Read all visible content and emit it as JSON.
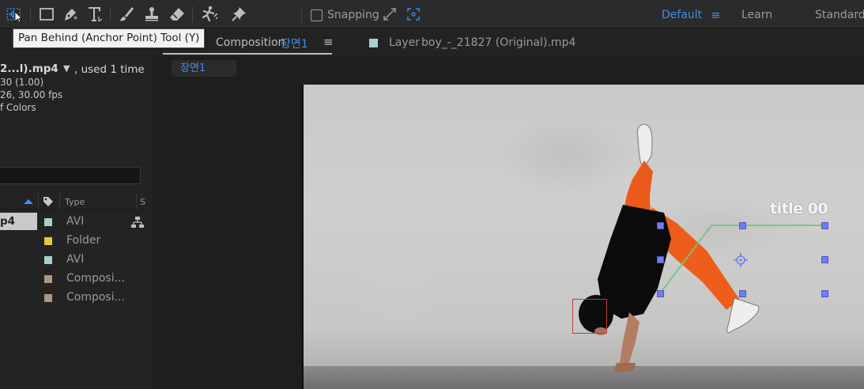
{
  "toolbar": {
    "tools": [
      {
        "name": "pan-behind-tool",
        "icon": "pan-behind-icon",
        "active": true
      },
      {
        "name": "rectangle-tool",
        "icon": "rectangle-icon"
      },
      {
        "name": "pen-tool",
        "icon": "pen-icon"
      },
      {
        "name": "type-tool",
        "icon": "type-icon"
      },
      {
        "name": "brush-tool",
        "icon": "brush-icon"
      },
      {
        "name": "clone-stamp-tool",
        "icon": "stamp-icon"
      },
      {
        "name": "eraser-tool",
        "icon": "eraser-icon"
      },
      {
        "name": "roto-brush-tool",
        "icon": "roto-brush-icon"
      },
      {
        "name": "puppet-pin-tool",
        "icon": "pin-icon"
      }
    ],
    "snapping_label": "Snapping",
    "snapping_checked": false,
    "workspaces": {
      "default": "Default",
      "learn": "Learn",
      "standard": "Standard"
    },
    "accent": "#3f8fe8"
  },
  "tooltip": {
    "text": "Pan Behind (Anchor Point) Tool (Y)"
  },
  "project": {
    "footage_name": "2...l).mp4",
    "used_text": ", used 1 time",
    "info_lines": [
      "30 (1.00)",
      "26, 30.00 fps",
      "f Colors"
    ],
    "columns": {
      "type": "Type",
      "s": "S"
    },
    "items": [
      {
        "name": "p4",
        "type": "AVI",
        "color": "#a9cdd0",
        "selected": true
      },
      {
        "name": "",
        "type": "Folder",
        "color": "#e6c63a"
      },
      {
        "name": "",
        "type": "AVI",
        "color": "#a9cdd0"
      },
      {
        "name": "",
        "type": "Composi...",
        "color": "#a99882"
      },
      {
        "name": "",
        "type": "Composi...",
        "color": "#a99882"
      }
    ]
  },
  "composition": {
    "tab_prefix": "Composition",
    "tab_name": "장면1",
    "layer_tab_prefix": "Layer",
    "layer_tab_name": "boy_-_21827 (Original).mp4",
    "sub_tab": "장면1"
  },
  "viewer": {
    "title_text": "title 00"
  }
}
